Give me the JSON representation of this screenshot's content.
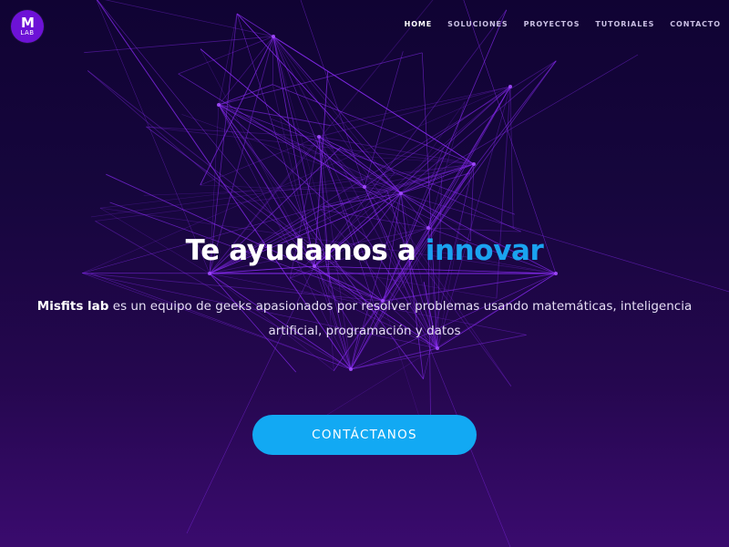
{
  "logo": {
    "mark": "M",
    "sub": "LAB"
  },
  "nav": {
    "items": [
      {
        "label": "HOME",
        "active": true
      },
      {
        "label": "SOLUCIONES",
        "active": false
      },
      {
        "label": "PROYECTOS",
        "active": false
      },
      {
        "label": "TUTORIALES",
        "active": false
      },
      {
        "label": "CONTACTO",
        "active": false
      }
    ]
  },
  "hero": {
    "title_main": "Te ayudamos a ",
    "title_accent": "innovar",
    "brand": "Misfits lab",
    "description": " es un equipo de geeks apasionados por resolver problemas usando matemáticas, inteligencia artificial, programación y datos",
    "cta_label": "CONTÁCTANOS"
  },
  "colors": {
    "background_top": "#100333",
    "background_bottom": "#3a0b6e",
    "accent": "#1aa3f0",
    "cta": "#12a9f3",
    "logo": "#6d12d6",
    "lines": "#8a2cf5"
  }
}
